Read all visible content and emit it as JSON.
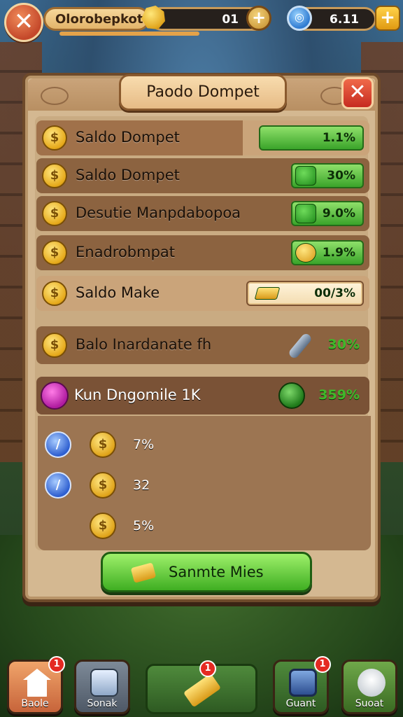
{
  "hud": {
    "player_name": "Olorobepkot",
    "gold_value": "01",
    "gem_value": "6.11",
    "gem_icon_label": "◎"
  },
  "panel": {
    "title": "Paodo Dompet",
    "rows": [
      {
        "label": "Saldo Dompet",
        "value": "1.1%"
      },
      {
        "label": "Saldo Dompet",
        "value": "30%"
      },
      {
        "label": "Desutie Manpdabopoa",
        "value": "9.0%"
      },
      {
        "label": "Enadrobmpat",
        "value": "1.9%"
      },
      {
        "label": "Saldo Make",
        "value": "00/3%"
      },
      {
        "label": "Balo Inardanate fh",
        "value": "30%"
      },
      {
        "label": "Kun Dngomile 1K",
        "value": "359%"
      }
    ],
    "mini_rows": [
      {
        "blue": "1",
        "value": "7%"
      },
      {
        "blue": "1",
        "value": "32"
      },
      {
        "value": "5%"
      }
    ],
    "cta_label": "Sanmte Mies"
  },
  "nav": {
    "left": {
      "label": "Baole",
      "badge": "1"
    },
    "second": {
      "label": "Sonak"
    },
    "center": {
      "badge": "1"
    },
    "fourth": {
      "label": "Guant",
      "badge": "1"
    },
    "right": {
      "label": "Suoat"
    }
  },
  "colors": {
    "panel_bg": "#d4b891",
    "accent_green": "#3fae22",
    "close_red": "#c62b20",
    "coin_gold": "#e6a91a"
  },
  "icons": {
    "coin": "$",
    "blue_token": "/"
  }
}
